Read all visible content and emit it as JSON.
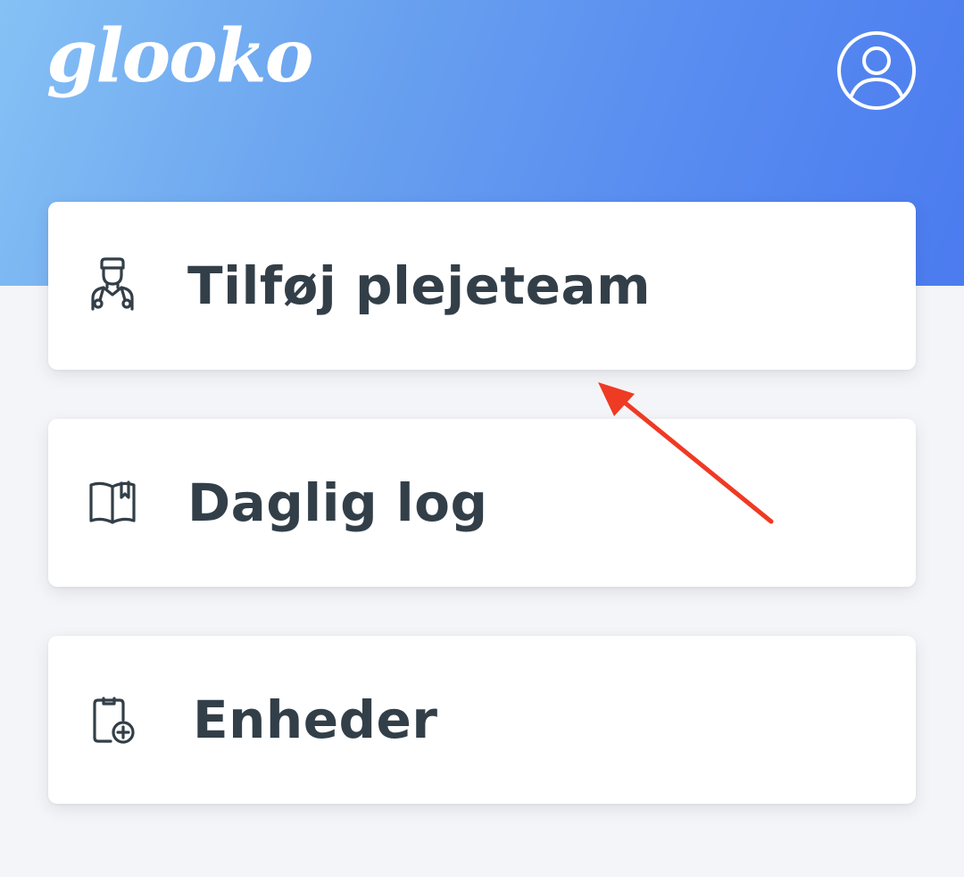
{
  "header": {
    "logo_text": "glooko",
    "profile_icon": "user-circle-icon",
    "gradient_colors": [
      "#86c1f5",
      "#4b7bef"
    ]
  },
  "menu": {
    "items": [
      {
        "label": "Tilføj plejeteam",
        "icon": "doctor-icon"
      },
      {
        "label": "Daglig log",
        "icon": "open-book-icon"
      },
      {
        "label": "Enheder",
        "icon": "device-add-icon"
      }
    ]
  },
  "annotation": {
    "arrow_color": "#ef3a24",
    "points_to": "Tilføj plejeteam"
  },
  "colors": {
    "text": "#333f48",
    "background": "#f4f5f8",
    "card": "#ffffff"
  }
}
